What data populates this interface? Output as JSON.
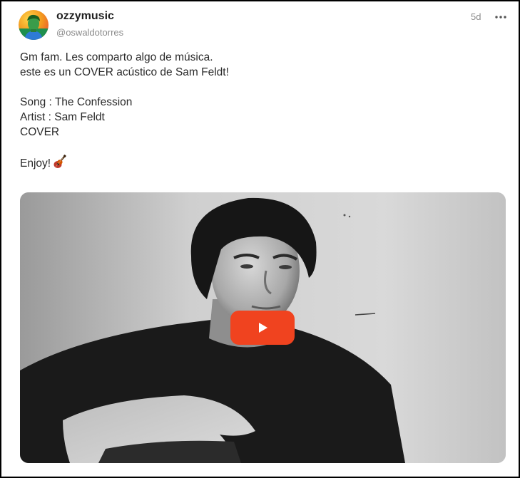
{
  "author": {
    "display_name": "ozzymusic",
    "handle": "@oswaldotorres",
    "avatar_icon": "avatar-portrait-icon"
  },
  "meta": {
    "time_ago": "5d",
    "more_icon": "more-horizontal-icon"
  },
  "post": {
    "lines": [
      "Gm fam. Les comparto algo de música.",
      "este es un COVER acústico de Sam Feldt!",
      "",
      "Song : The Confession",
      "Artist : Sam Feldt",
      "COVER",
      "",
      "Enjoy!"
    ],
    "emoji": "guitar-icon"
  },
  "media": {
    "type": "video",
    "play_icon": "play-icon",
    "play_color": "#f0431f"
  },
  "colors": {
    "text": "#2a2a2a",
    "muted": "#8a8a8a",
    "frame": "#000000"
  }
}
